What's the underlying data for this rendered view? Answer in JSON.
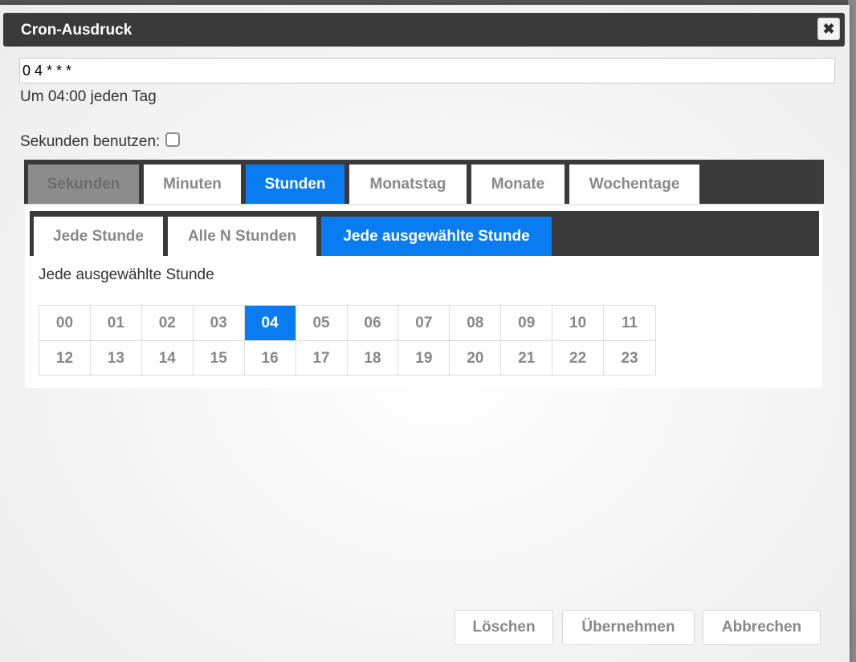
{
  "dialog": {
    "title": "Cron-Ausdruck",
    "close_glyph": "✖"
  },
  "cron": {
    "expression": "0 4 * * *",
    "description": "Um 04:00 jeden Tag"
  },
  "seconds": {
    "label": "Sekunden benutzen:",
    "checked": false
  },
  "tabs": [
    {
      "label": "Sekunden",
      "state": "disabled"
    },
    {
      "label": "Minuten",
      "state": "normal"
    },
    {
      "label": "Stunden",
      "state": "active"
    },
    {
      "label": "Monatstag",
      "state": "normal"
    },
    {
      "label": "Monate",
      "state": "normal"
    },
    {
      "label": "Wochentage",
      "state": "normal"
    }
  ],
  "subtabs": [
    {
      "label": "Jede Stunde",
      "state": "normal"
    },
    {
      "label": "Alle N Stunden",
      "state": "normal"
    },
    {
      "label": "Jede ausgewählte Stunde",
      "state": "active"
    }
  ],
  "panel": {
    "label": "Jede ausgewählte Stunde"
  },
  "hours": [
    "00",
    "01",
    "02",
    "03",
    "04",
    "05",
    "06",
    "07",
    "08",
    "09",
    "10",
    "11",
    "12",
    "13",
    "14",
    "15",
    "16",
    "17",
    "18",
    "19",
    "20",
    "21",
    "22",
    "23"
  ],
  "selected_hours": [
    "04"
  ],
  "footer": {
    "delete_label": "Löschen",
    "apply_label": "Übernehmen",
    "cancel_label": "Abbrechen"
  },
  "colors": {
    "accent": "#0a7cf1",
    "titlebar": "#3a3a3a"
  }
}
